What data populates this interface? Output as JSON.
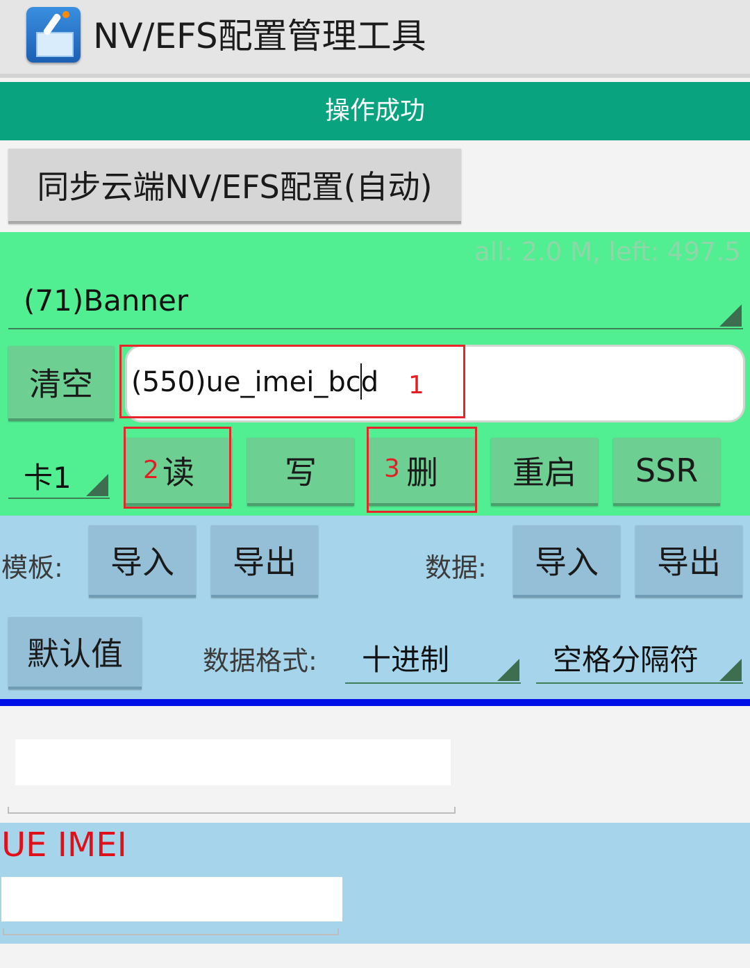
{
  "app": {
    "title": "NV/EFS配置管理工具",
    "icon": "app-dropper-icon"
  },
  "status": {
    "message": "操作成功"
  },
  "sync": {
    "label": "同步云端NV/EFS配置(自动)"
  },
  "memory": {
    "text": "all: 2.0 M, left: 497.5 K"
  },
  "nv_group": {
    "selected": "(71)Banner"
  },
  "clear": {
    "label": "清空"
  },
  "item": {
    "value": "(550)ue_imei_bcd"
  },
  "card": {
    "selected": "卡1"
  },
  "actions": {
    "read": "读",
    "write": "写",
    "delete": "删",
    "restart": "重启",
    "ssr": "SSR"
  },
  "annotations": {
    "n1": "1",
    "n2": "2",
    "n3": "3"
  },
  "template": {
    "label": "模板:",
    "import": "导入",
    "export": "导出"
  },
  "data_io": {
    "label": "数据:",
    "import": "导入",
    "export": "导出"
  },
  "defaults": {
    "label": "默认值"
  },
  "format": {
    "label": "数据格式:",
    "base": "十进制",
    "separator": "空格分隔符"
  },
  "result": {
    "field_value": ""
  },
  "imei": {
    "title": "UE IMEI",
    "field_value": ""
  },
  "colors": {
    "status_bg": "#0aa380",
    "panel_green": "#52ee92",
    "panel_blue": "#a6d4ea",
    "divider": "#0010e6",
    "annotation_red": "#e8252a",
    "imei_title": "#e0101a"
  }
}
